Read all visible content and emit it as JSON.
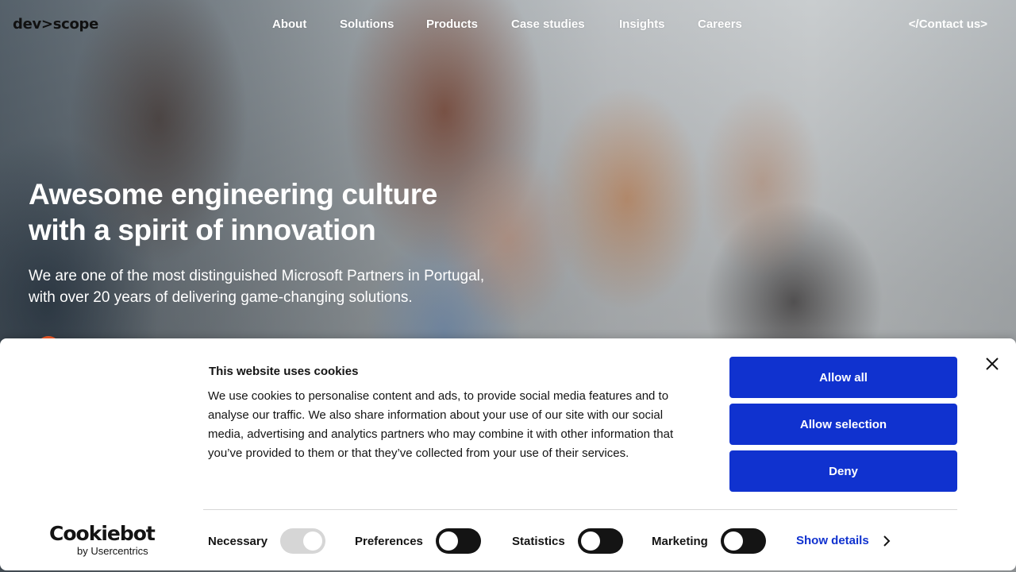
{
  "header": {
    "logo": "dev>scope",
    "nav": [
      {
        "label": "About"
      },
      {
        "label": "Solutions"
      },
      {
        "label": "Products"
      },
      {
        "label": "Case studies"
      },
      {
        "label": "Insights"
      },
      {
        "label": "Careers"
      }
    ],
    "contact": "</Contact us>"
  },
  "hero": {
    "title_line1": "Awesome engineering culture",
    "title_line2": "with a spirit of innovation",
    "subtitle_line1": "We are one of the most distinguished Microsoft Partners in Portugal,",
    "subtitle_line2": "with over 20 years of delivering game-changing solutions."
  },
  "cookie_banner": {
    "title": "This website uses cookies",
    "body": "We use cookies to personalise content and ads, to provide social media features and to analyse our traffic. We also share information about your use of our site with our social media, advertising and analytics partners who may combine it with other information that you’ve provided to them or that they’ve collected from your use of their services.",
    "buttons": {
      "allow_all": "Allow all",
      "allow_selection": "Allow selection",
      "deny": "Deny"
    },
    "close_icon": "close-icon",
    "branding": {
      "name": "Cookiebot",
      "sub": "by Usercentrics"
    },
    "toggles": [
      {
        "label": "Necessary",
        "checked": true,
        "disabled": true
      },
      {
        "label": "Preferences",
        "checked": false,
        "disabled": false
      },
      {
        "label": "Statistics",
        "checked": false,
        "disabled": false
      },
      {
        "label": "Marketing",
        "checked": false,
        "disabled": false
      }
    ],
    "show_details": "Show details",
    "colors": {
      "accent": "#1032cf",
      "toggle_off": "#141414",
      "toggle_disabled": "#d6d6d6"
    }
  }
}
